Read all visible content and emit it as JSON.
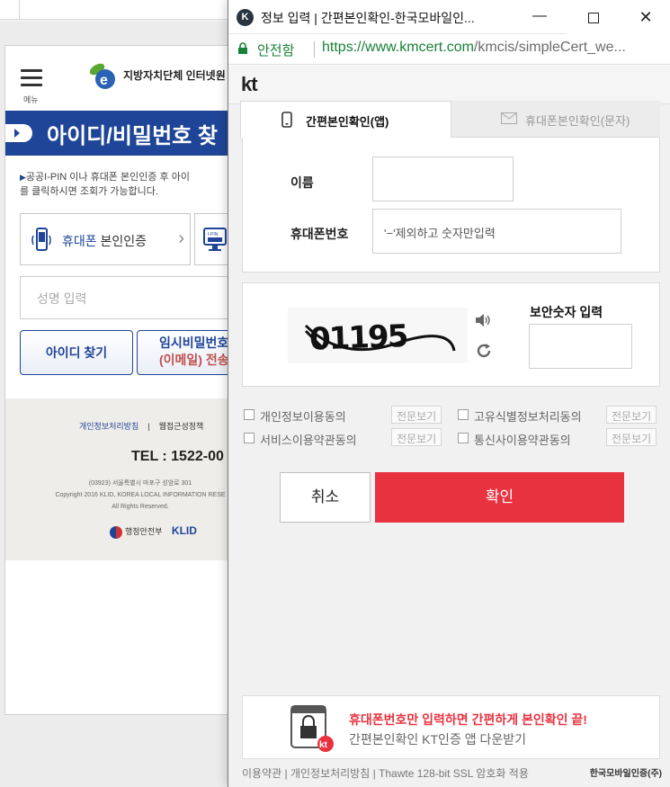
{
  "background": {
    "menu_label": "메뉴",
    "site_name": "지방자치단체 인터넷원",
    "page_title": "아이디/비밀번호 찾",
    "desc_line1": "공공I-PIN 이나 휴대폰 본인인증 후 아이",
    "desc_line2": "를 클릭하시면 조회가 가능합니다.",
    "phone_auth_highlight": "휴대폰",
    "phone_auth_rest": " 본인인증",
    "ipin_icon_text": "I-PIN",
    "name_placeholder": "성명 입력",
    "find_id_button": "아이디 찾기",
    "temp_pw_line1": "임시비밀번호",
    "temp_pw_line2": "(이메일) 전송",
    "footer": {
      "privacy_link": "개인정보처리방침",
      "sep": "|",
      "web_access_link": "웹접근성정책",
      "tel": "TEL : 1522-00",
      "addr_line1": "(03923) 서울특별시 마포구 성암로 301",
      "addr_line2": "Copyright 2016 KLID, KOREA LOCAL INFORMATION RESE",
      "addr_line3": "All Rights Reserved.",
      "mois": "행정안전부",
      "klid": "KLID"
    }
  },
  "popup": {
    "window_title": "정보 입력 | 간편본인확인-한국모바일인...",
    "secure_label": "안전함",
    "url_host": "https://www.kmcert.com",
    "url_path": "/kmcis/simpleCert_we...",
    "kt_logo": "kt",
    "tabs": [
      {
        "label": "간편본인확인(앱)",
        "active": true
      },
      {
        "label": "휴대폰본인확인(문자)",
        "active": false
      }
    ],
    "name_label": "이름",
    "phone_label": "휴대폰번호",
    "phone_placeholder": "'−'제외하고 숫자만입력",
    "captcha_text": "01195",
    "captcha_label": "보안숫자 입력",
    "agreements": [
      {
        "label": "개인정보이용동의",
        "view": "전문보기"
      },
      {
        "label": "고유식별정보처리동의",
        "view": "전문보기"
      },
      {
        "label": "서비스이용약관동의",
        "view": "전문보기"
      },
      {
        "label": "통신사이용약관동의",
        "view": "전문보기"
      }
    ],
    "cancel_label": "취소",
    "confirm_label": "확인",
    "banner_line1": "휴대폰번호만 입력하면 간편하게 본인확인 끝!",
    "banner_line2": "간편본인확인 KT인증 앱 다운받기",
    "banner_badge": "kt",
    "footer_links": "이용약관 | 개인정보처리방침 | Thawte 128-bit SSL 암호화 적용",
    "footer_brand": "한국모바일인증(주)",
    "accent_color": "#e83240",
    "secure_color": "#188038"
  }
}
